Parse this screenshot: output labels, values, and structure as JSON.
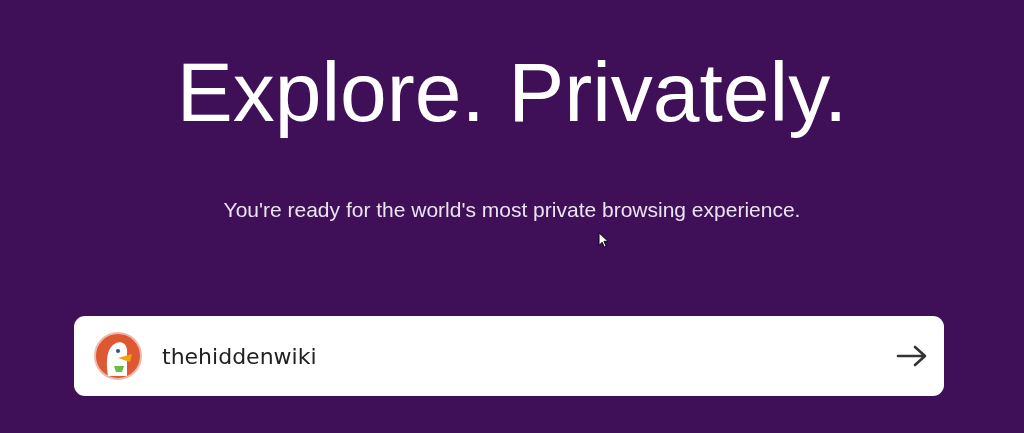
{
  "heading": "Explore. Privately.",
  "subheading": "You're ready for the world's most private browsing experience.",
  "search": {
    "value": "thehiddenwiki"
  }
}
